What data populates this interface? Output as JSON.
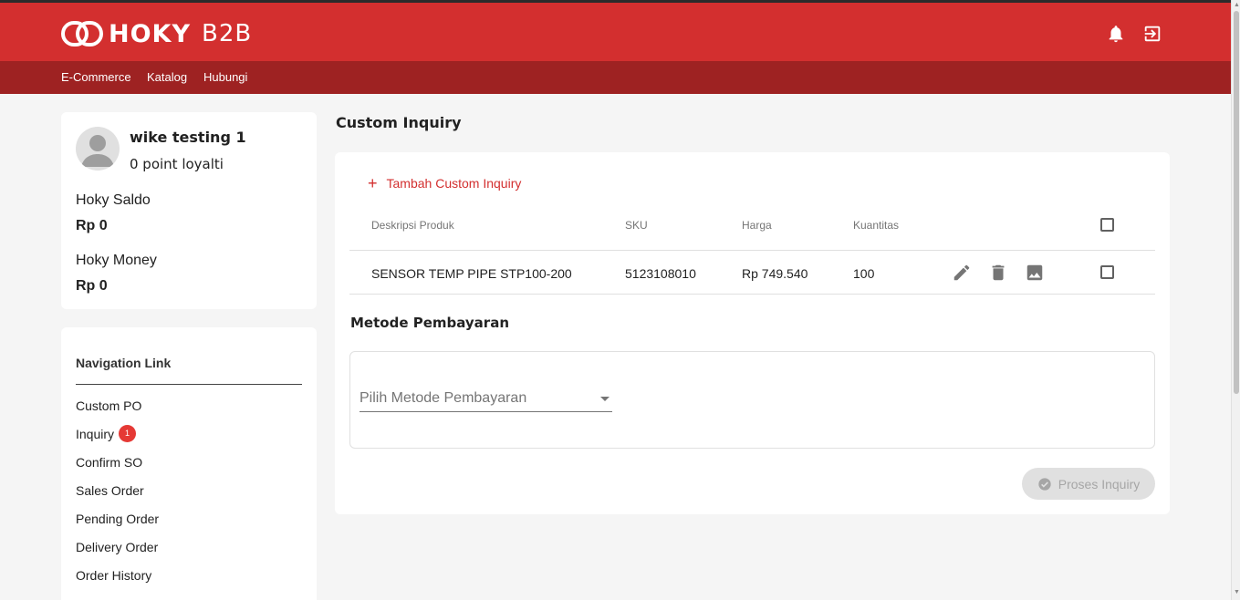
{
  "header": {
    "brand": "HOKY",
    "brand_suffix": "B2B",
    "brand_color": "#d32f2f",
    "icons": [
      "bell-icon",
      "logout-icon"
    ]
  },
  "nav": {
    "color": "#9e2222",
    "items": [
      {
        "label": "E-Commerce"
      },
      {
        "label": "Katalog"
      },
      {
        "label": "Hubungi"
      }
    ]
  },
  "profile": {
    "name": "wike testing 1",
    "points": "0 point loyalti",
    "saldo_label": "Hoky Saldo",
    "saldo_value": "Rp 0",
    "money_label": "Hoky Money",
    "money_value": "Rp 0"
  },
  "sidebar": {
    "title": "Navigation Link",
    "items": [
      {
        "label": "Custom PO"
      },
      {
        "label": "Inquiry",
        "badge": "1"
      },
      {
        "label": "Confirm SO"
      },
      {
        "label": "Sales Order"
      },
      {
        "label": "Pending Order"
      },
      {
        "label": "Delivery Order"
      },
      {
        "label": "Order History"
      }
    ]
  },
  "main": {
    "title": "Custom Inquiry",
    "add_label": "Tambah Custom Inquiry",
    "table": {
      "columns": [
        "Deskripsi Produk",
        "SKU",
        "Harga",
        "Kuantitas"
      ],
      "rows": [
        {
          "description": "SENSOR TEMP PIPE STP100-200",
          "sku": "5123108010",
          "price": "Rp 749.540",
          "qty": "100",
          "checked": false
        }
      ]
    },
    "payment": {
      "title": "Metode Pembayaran",
      "placeholder": "Pilih Metode Pembayaran"
    },
    "submit_label": "Proses Inquiry"
  }
}
